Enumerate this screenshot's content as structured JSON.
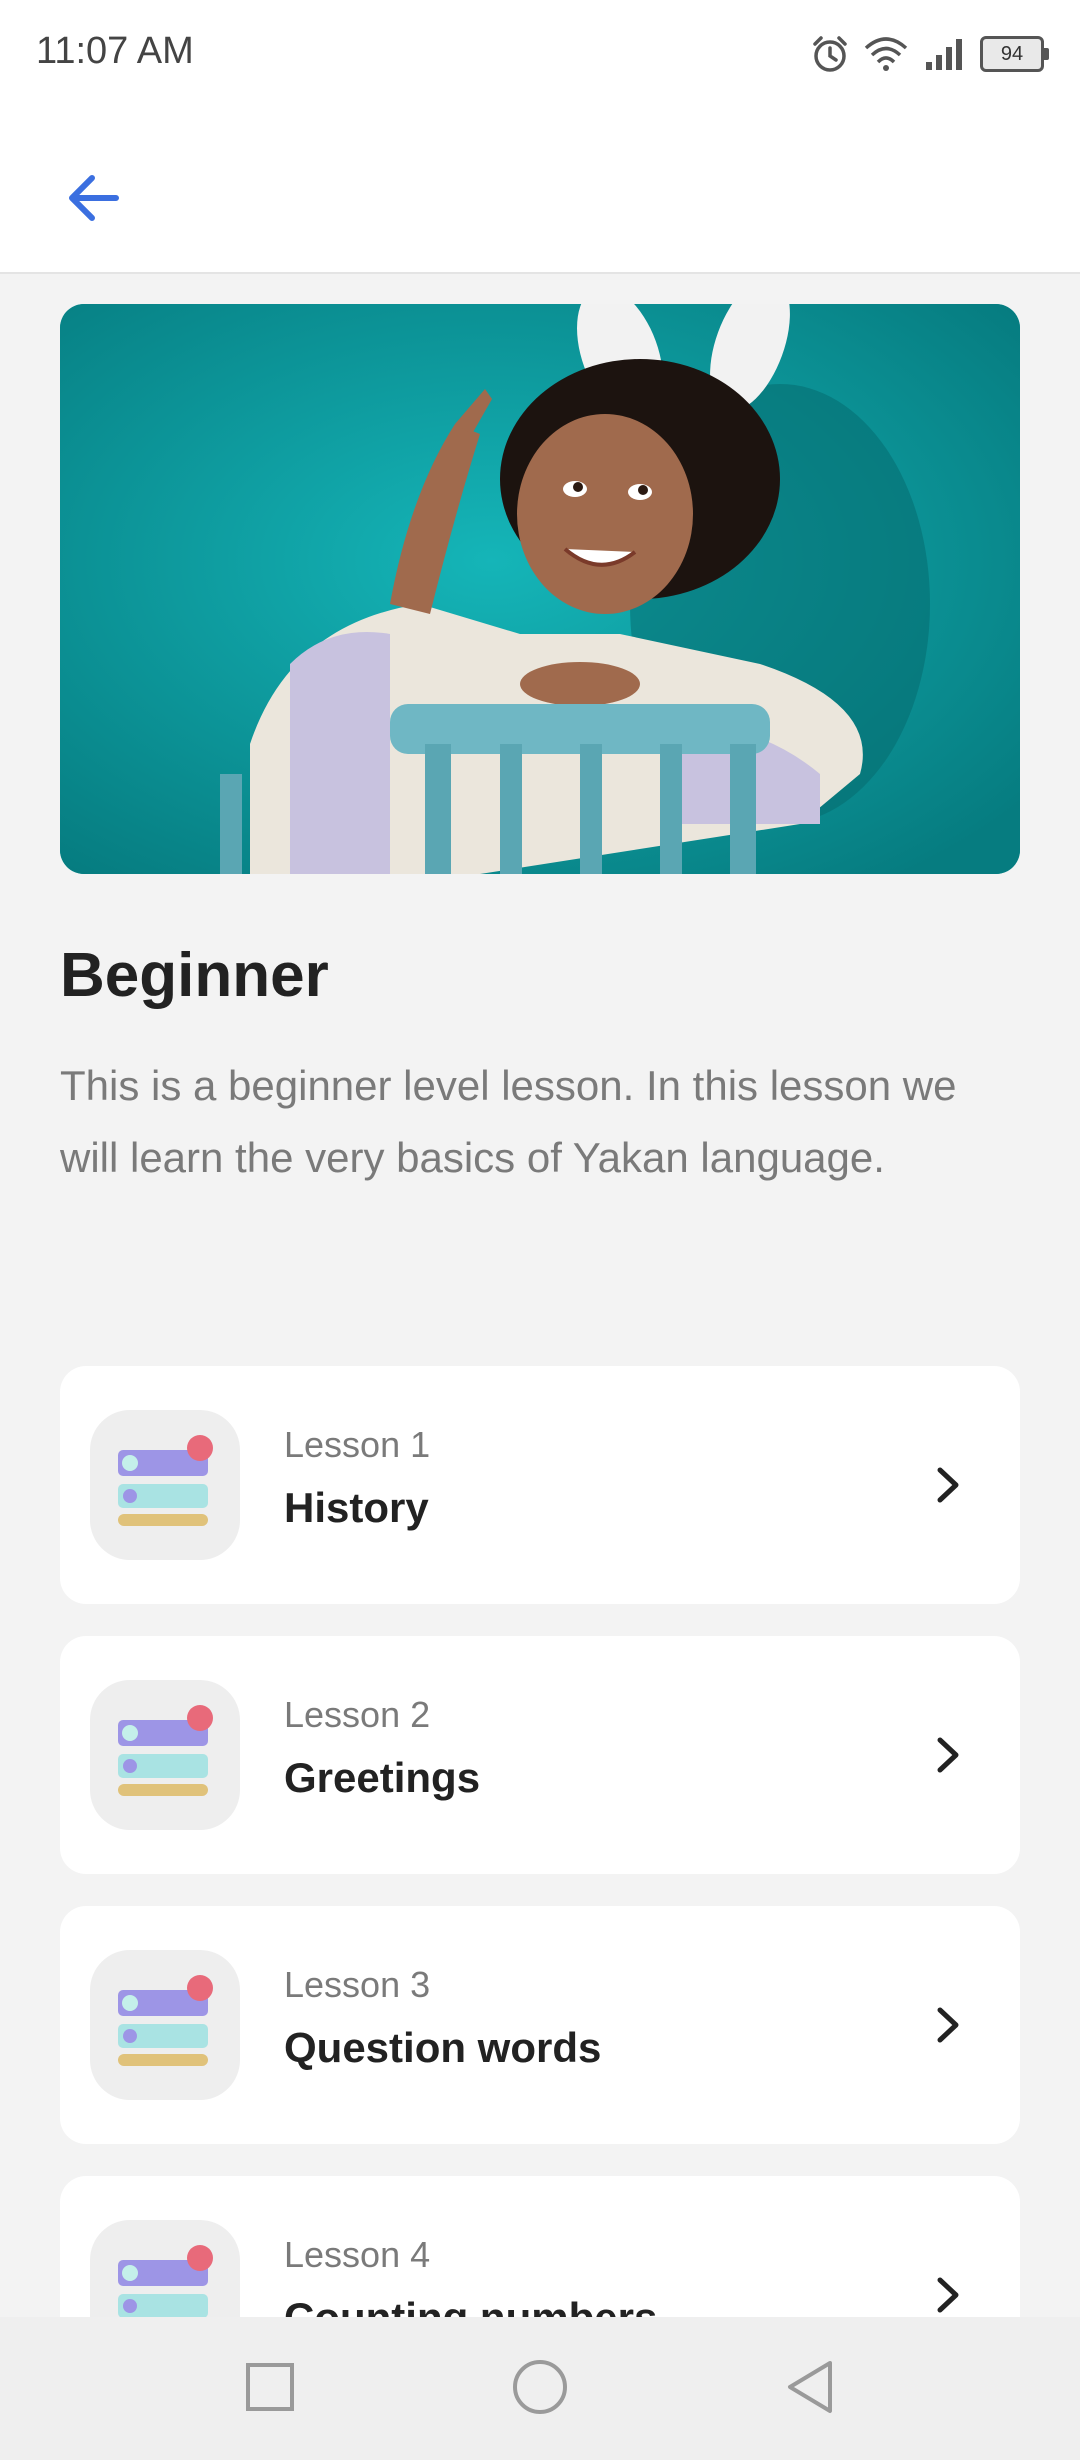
{
  "status_bar": {
    "time": "11:07 AM",
    "battery": "94",
    "icons": [
      "alarm-icon",
      "wifi-icon",
      "signal-icon",
      "battery-icon"
    ]
  },
  "app_bar": {
    "back_icon": "arrow-left-icon",
    "accent_color": "#3b6fe0"
  },
  "hero": {
    "image": "Child with bunny ears sitting on a teal chair against a teal wall, pointing up"
  },
  "level": {
    "title": "Beginner",
    "description": "This is a beginner level lesson. In this lesson we will learn the very basics of Yakan language."
  },
  "lessons": [
    {
      "number": "Lesson 1",
      "title": "History"
    },
    {
      "number": "Lesson 2",
      "title": "Greetings"
    },
    {
      "number": "Lesson 3",
      "title": "Question words"
    },
    {
      "number": "Lesson 4",
      "title": "Counting numbers"
    }
  ],
  "nav_bar": {
    "items": [
      "recents-square-icon",
      "home-circle-icon",
      "back-triangle-icon"
    ]
  }
}
